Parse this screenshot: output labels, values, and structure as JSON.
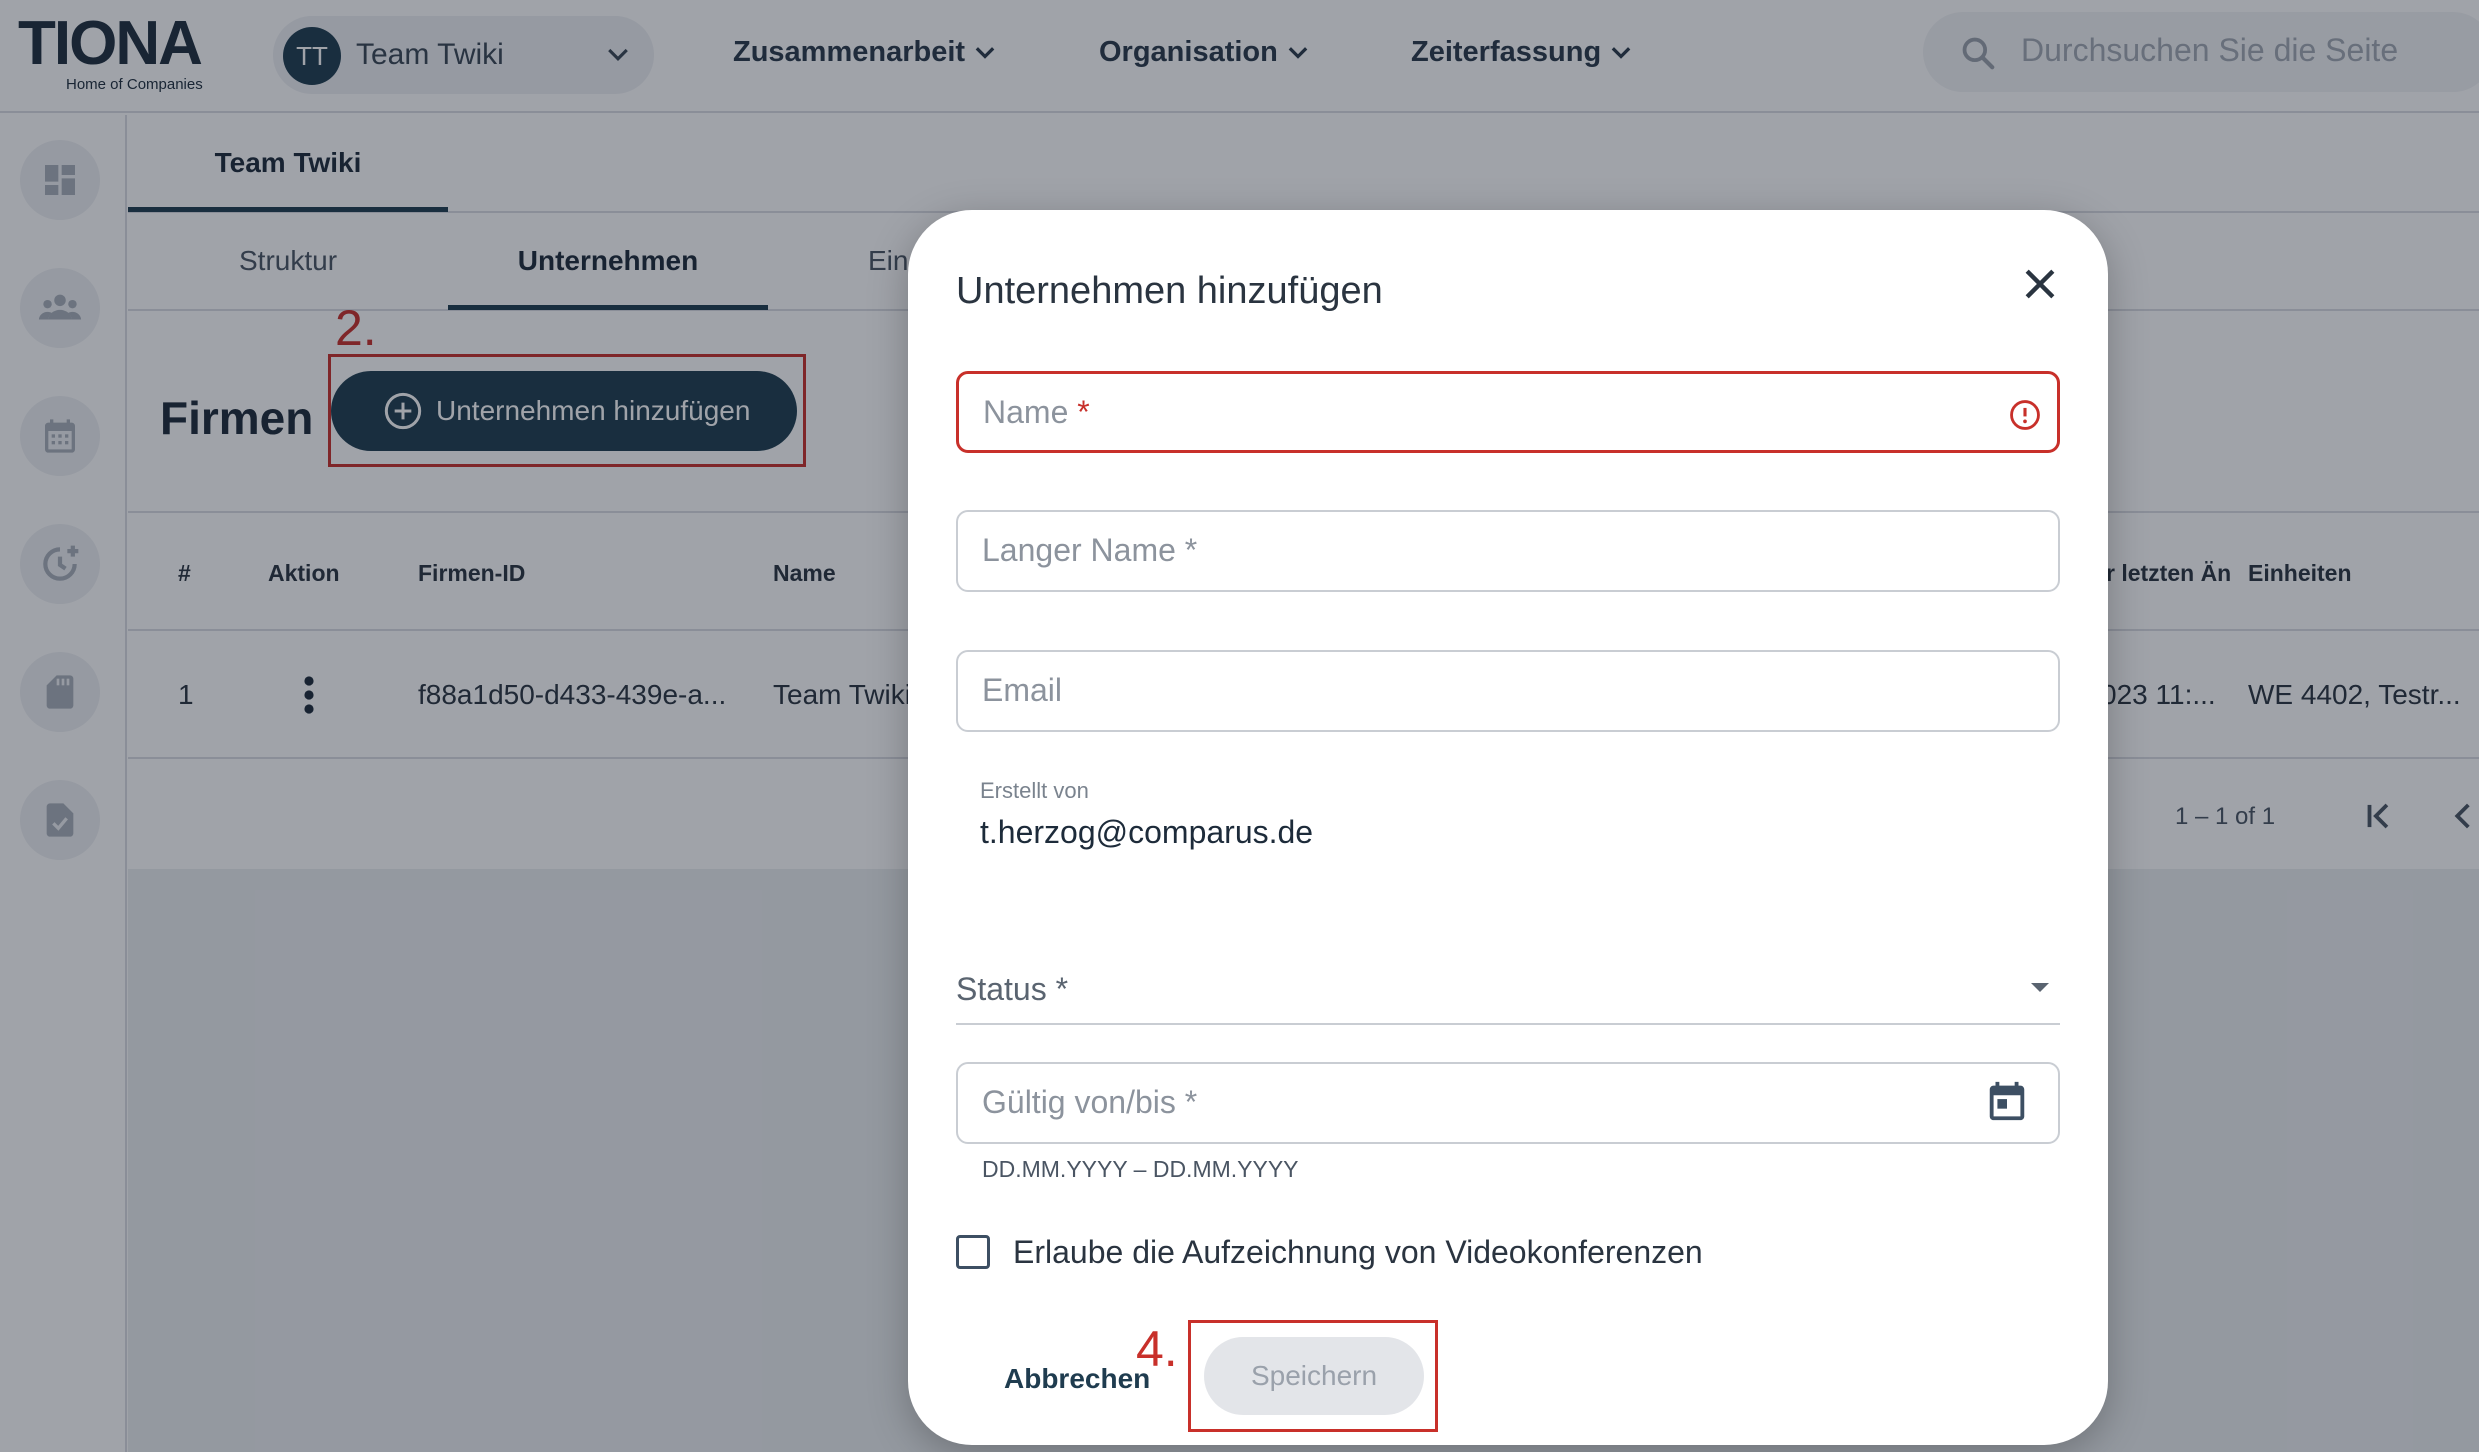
{
  "topbar": {
    "logo_text": "TIONA",
    "logo_tagline": "Home of Companies",
    "team_avatar": "TT",
    "team_name": "Team Twiki",
    "nav": [
      {
        "label": "Zusammenarbeit"
      },
      {
        "label": "Organisation"
      },
      {
        "label": "Zeiterfassung"
      }
    ],
    "search_placeholder": "Durchsuchen Sie die Seite"
  },
  "sidebar": {
    "icons": [
      "dashboard-icon",
      "people-icon",
      "calendar-icon",
      "clock-add-icon",
      "sd-card-icon",
      "task-check-icon"
    ]
  },
  "main": {
    "tabs_primary": [
      {
        "label": "Team Twiki"
      }
    ],
    "tabs_secondary": [
      {
        "label": "Struktur"
      },
      {
        "label": "Unternehmen"
      },
      {
        "label": "Ein"
      }
    ],
    "section_title": "Firmen",
    "add_button": "Unternehmen hinzufügen",
    "step2_label": "2.",
    "table": {
      "headers": [
        "#",
        "Aktion",
        "Firmen-ID",
        "Name",
        "r letzten Än",
        "Einheiten"
      ],
      "rows": [
        {
          "num": "1",
          "id": "f88a1d50-d433-439e-a...",
          "name": "Team Twiki",
          "changed": "023 11:...",
          "units": "WE 4402, Testr..."
        }
      ]
    },
    "pagination": "1 – 1 of 1"
  },
  "dialog": {
    "title": "Unternehmen hinzufügen",
    "fields": {
      "name_placeholder": "Name",
      "long_name_placeholder": "Langer Name *",
      "email_placeholder": "Email",
      "created_by_label": "Erstellt von",
      "created_by_value": "t.herzog@comparus.de",
      "status_label": "Status *",
      "valid_placeholder": "Gültig von/bis *",
      "valid_hint": "DD.MM.YYYY – DD.MM.YYYY"
    },
    "required_star": "*",
    "checkbox_label": "Erlaube die Aufzeichnung von Videokonferenzen",
    "checkbox_checked": false,
    "cancel_label": "Abbrechen",
    "save_label": "Speichern",
    "step4_label": "4."
  },
  "colors": {
    "brand": "#1e3d4f",
    "error": "#c8302a",
    "annotation": "#c8302a"
  }
}
